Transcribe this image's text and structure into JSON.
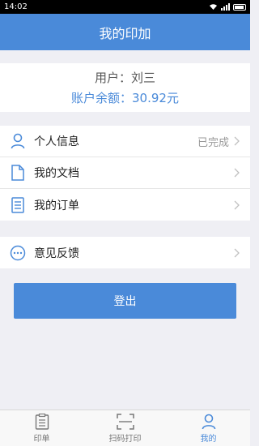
{
  "statusbar": {
    "time": "14:02"
  },
  "navbar": {
    "title": "我的印加"
  },
  "account": {
    "user": "用户：刘三",
    "balance": "账户余额：30.92元"
  },
  "menu": {
    "profile": {
      "label": "个人信息",
      "status": "已完成",
      "icon": "user-icon"
    },
    "documents": {
      "label": "我的文档",
      "icon": "document-icon"
    },
    "orders": {
      "label": "我的订单",
      "icon": "list-icon"
    },
    "feedback": {
      "label": "意见反馈",
      "icon": "chat-icon"
    }
  },
  "logout_label": "登出",
  "tabs": [
    {
      "label": "印单",
      "icon": "clipboard-icon",
      "active": false
    },
    {
      "label": "扫码打印",
      "icon": "scan-icon",
      "active": false
    },
    {
      "label": "我的",
      "icon": "person-icon",
      "active": true
    }
  ],
  "colors": {
    "accent": "#4a8ad9",
    "background": "#efeff4"
  }
}
